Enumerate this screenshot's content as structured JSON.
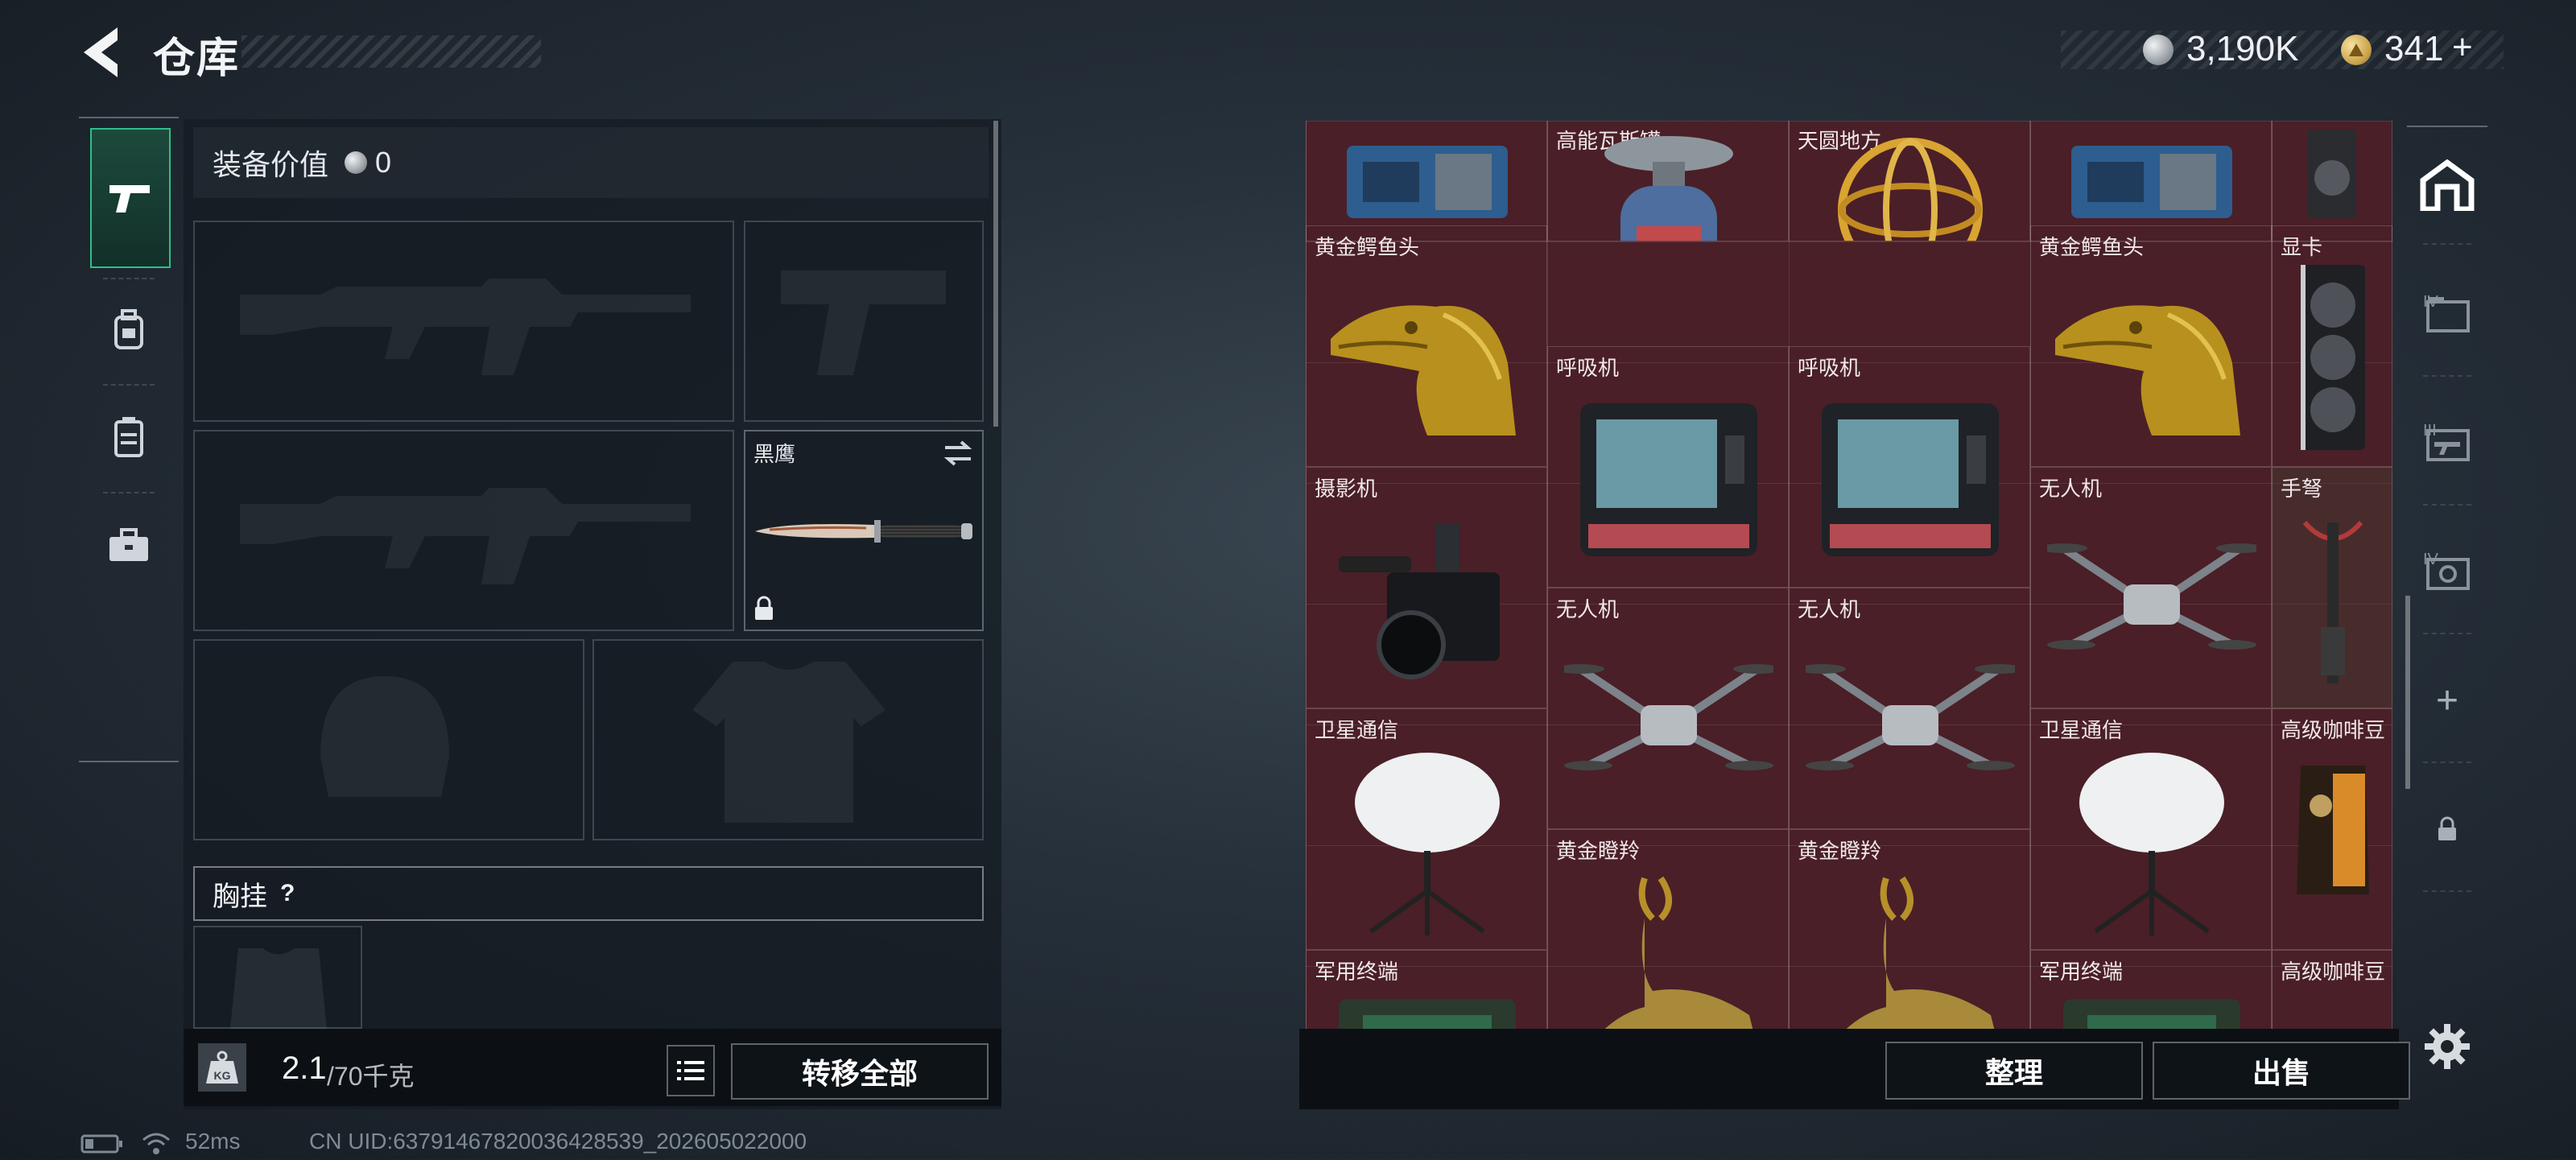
{
  "header": {
    "title": "仓库",
    "currency_silver": "3,190K",
    "currency_gold": "341",
    "gold_plus": "+"
  },
  "left_panel": {
    "equipment_value_label": "装备价值",
    "equipment_value": "0",
    "knife_slot_label": "黑鹰",
    "chest_rig_label": "胸挂",
    "chest_rig_help": "?",
    "weight_current": "2.1",
    "weight_capacity": "/70千克",
    "weight_icon_text": "KG",
    "transfer_all_label": "转移全部"
  },
  "grid": {
    "top_labels": [
      "高能瓦斯罐",
      "天圆地方"
    ],
    "items": [
      {
        "label": "黄金鳄鱼头"
      },
      {
        "label": "呼吸机"
      },
      {
        "label": "呼吸机"
      },
      {
        "label": "黄金鳄鱼头"
      },
      {
        "label": "显卡"
      },
      {
        "label": "摄影机"
      },
      {
        "label": "无人机"
      },
      {
        "label": "无人机"
      },
      {
        "label": "无人机"
      },
      {
        "label": "手弩"
      },
      {
        "label": "卫星通信"
      },
      {
        "label": "卫星通信"
      },
      {
        "label": "高级咖啡豆"
      },
      {
        "label": "黄金瞪羚"
      },
      {
        "label": "黄金瞪羚"
      },
      {
        "label": "军用终端"
      },
      {
        "label": "军用终端"
      },
      {
        "label": "高级咖啡豆"
      }
    ],
    "sort_label": "整理",
    "sell_label": "出售"
  },
  "right_rail": {
    "tab_labels": [
      "IV",
      "III",
      "IV"
    ],
    "add_label": "+"
  },
  "footer": {
    "ping": "52ms",
    "uid": "CN UID:6379146782003642853​9_202605022000"
  },
  "colors": {
    "accent_green": "#2fbf8a",
    "grid_bg": "#4a1f27",
    "panel_bg": "#141a21"
  }
}
